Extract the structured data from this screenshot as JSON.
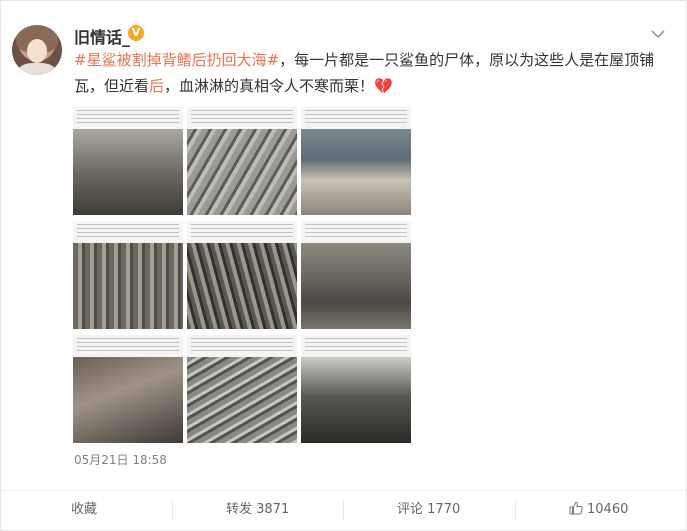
{
  "author": {
    "name": "旧情话_",
    "badge": "V"
  },
  "post": {
    "topic": "#星鲨被割掉背鳍后扔回大海#",
    "text_1": "，每一片都是一只鲨鱼的尸体，原以为这些人是在屋顶铺瓦，但近看",
    "highlight": "后",
    "text_2": "，血淋淋的真相令人不寒而栗！",
    "emoji": "💔"
  },
  "timestamp": "05月21日 18:58",
  "actions": {
    "favorite": "收藏",
    "repost": "转发 3871",
    "comment": "评论 1770",
    "like": "10460"
  },
  "icons": {
    "menu": "chevron-down-icon",
    "like": "thumbs-up-icon"
  },
  "colors": {
    "topic": "#eb7350",
    "badge": "#f5a623"
  }
}
